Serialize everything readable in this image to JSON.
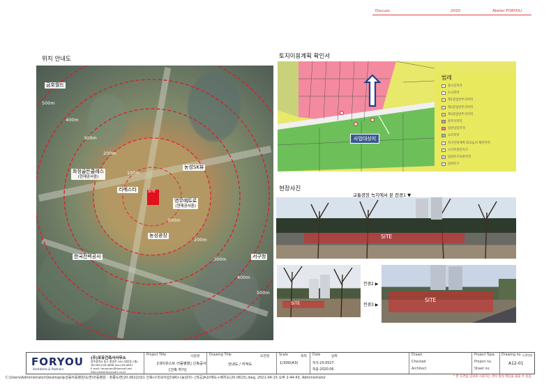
{
  "header": {
    "strip": [
      "Discuss",
      "2020",
      "Atelier FORYOU"
    ]
  },
  "location": {
    "title": "위치 안내도",
    "rings": [
      "500m",
      "400m",
      "300m",
      "200m",
      "100m",
      "100m",
      "200m",
      "300m",
      "400m",
      "500m"
    ],
    "labels": {
      "geumho": "금호월드",
      "hwajeong": "화정골든클래스",
      "hwajeong_sub": "(현재공사중)",
      "rimesta": "리메스타",
      "nongseong_sk": "농성SK뷰",
      "yeongwoo": "영무예트로",
      "yeongwoo_sub": "(현재공사중)",
      "plaza": "농성광장",
      "kepco": "한국전력공사",
      "city_hall": "서구청",
      "site": "SITE"
    }
  },
  "landuse": {
    "title": "토지이용계획 확인서",
    "legend_title": "범례",
    "legend": [
      {
        "label": "중소민지역",
        "color": "#f4f4c8"
      },
      {
        "label": "도시지역",
        "color": "#ffffff"
      },
      {
        "label": "제1종일반주거지역",
        "color": "#f6e9a0"
      },
      {
        "label": "제2종일반주거지역",
        "color": "#efe48a"
      },
      {
        "label": "제3종일반주거지역",
        "color": "#e3d86a"
      },
      {
        "label": "준주거지역",
        "color": "#d49a7a"
      },
      {
        "label": "일반상업지역",
        "color": "#f07a8a"
      },
      {
        "label": "녹지지역",
        "color": "#9cc07a"
      },
      {
        "label": "지구단위계획 최고높이 제한지역",
        "color": "#f4f0e0"
      },
      {
        "label": "시가지경관지구",
        "color": "#f2eec0"
      },
      {
        "label": "방화지구보존지역",
        "color": "#f4c8d0"
      },
      {
        "label": "방화지구",
        "color": "#e8e0f0"
      }
    ],
    "site_tag": "사업대상지"
  },
  "photos": {
    "title": "현장사진",
    "caption_main": "교통광장 녹지에서 본 전경1 ▼",
    "view2": "전경2 ▶",
    "view3": "전경3 ▶",
    "site": "SITE"
  },
  "titleblock": {
    "logo": "FORYOU",
    "logo_sub": "Architects & Partners",
    "firm": "(주)포유건축사사무소",
    "firm_addr": "광주광역시 동구 중앙로 160 (대인동 2층)",
    "firm_tel": "Tel:062)226-9898  Fax:226-9897",
    "firm_mail": "E-mail: foryouarc@hanmail.net",
    "firm_web": "http://www.foryouarc.co.kr",
    "project_title_hd": "Project Title",
    "project_title_hd2": "사업명",
    "project_title": "[데이유스트 이동병원] 신축공사",
    "project_title2": "[건축 허가]",
    "drawing_title_hd": "Drawing Title",
    "drawing_title_hd2": "도면명",
    "drawing_title": "안내도 / 지적도",
    "scale_hd": "Scale",
    "scale_hd2": "축척",
    "scale": "1/300(A3)",
    "date_hd": "Date",
    "date_hd2": "날짜",
    "date1": "허가-20.0527.",
    "date2": "착공-2020.06.",
    "drawn": "Drawn",
    "checked": "Checked",
    "architect": "Architect",
    "project_type": "Project Type.",
    "project_no": "Project no.",
    "sheet_no": "Sheet no.",
    "drawing_no_hd": "Drawing no.",
    "drawing_no_hd2": "도면번호",
    "drawing_no": "A12-01"
  },
  "footer": {
    "path": "C:\\Users\\Administrator\\Desktop\\농성동아동병원\\도면\\아동병원 - 최종도면(20.0622)\\01 건축(구조모아값)\\WO-(농성아)- [착공]A10계도+배치도(20.0615).dwg, 2021-04-15 오후 2:44:43, Administrator",
    "note": "* 본 도면을 임의로 사용하는 경우 법적 책임을 물을 수 있음"
  }
}
